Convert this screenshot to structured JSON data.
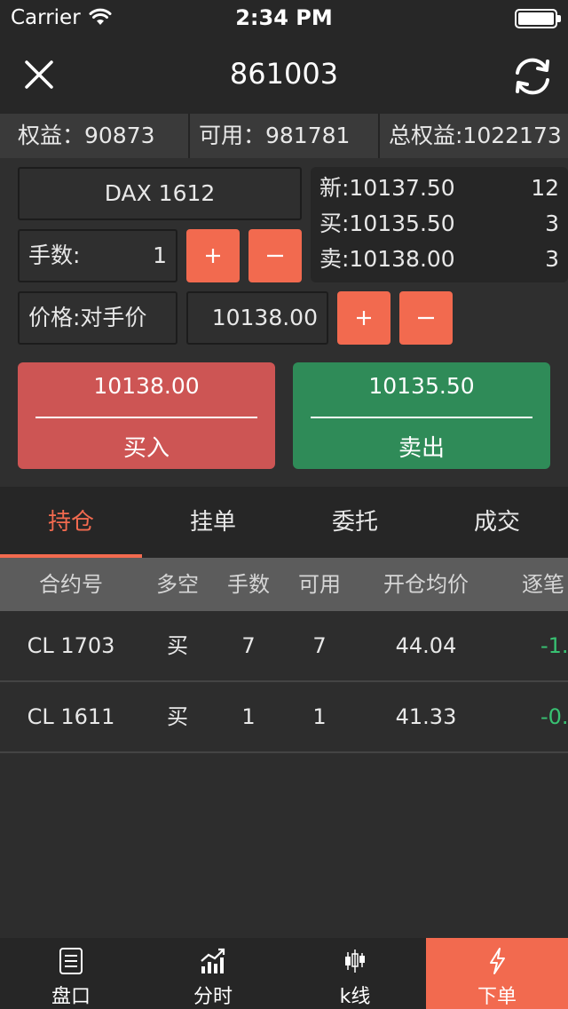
{
  "status_bar": {
    "carrier": "Carrier",
    "time": "2:34 PM"
  },
  "nav": {
    "title": "861003"
  },
  "account": {
    "equity": "权益：90873",
    "available": "可用：981781",
    "total_equity": "总权益:1022173"
  },
  "order": {
    "symbol": "DAX 1612",
    "qty_label": "手数:",
    "qty_value": "1",
    "price_type": "价格:对手价",
    "price_value": "10138.00",
    "plus_symbol": "+",
    "minus_symbol": "−"
  },
  "quote": {
    "last": {
      "price": "新:10137.50",
      "volume": "12"
    },
    "bid": {
      "price": "买:10135.50",
      "volume": "3"
    },
    "ask": {
      "price": "卖:10138.00",
      "volume": "3"
    }
  },
  "buy_button": {
    "price": "10138.00",
    "label": "买入"
  },
  "sell_button": {
    "price": "10135.50",
    "label": "卖出"
  },
  "tabs": [
    {
      "label": "持仓"
    },
    {
      "label": "挂单"
    },
    {
      "label": "委托"
    },
    {
      "label": "成交"
    }
  ],
  "active_tab": "持仓",
  "table": {
    "headers": [
      "合约号",
      "多空",
      "手数",
      "可用",
      "开仓均价",
      "逐笔"
    ],
    "rows": [
      [
        "CL 1703",
        "买",
        "7",
        "7",
        "44.04",
        "-1."
      ],
      [
        "CL 1611",
        "买",
        "1",
        "1",
        "41.33",
        "-0."
      ]
    ]
  },
  "tabbar": [
    {
      "label": "盘口",
      "icon": "list-icon"
    },
    {
      "label": "分时",
      "icon": "chart-trend-icon"
    },
    {
      "label": "k线",
      "icon": "candlestick-icon"
    },
    {
      "label": "下单",
      "icon": "lightning-icon"
    }
  ],
  "colors": {
    "accent": "#f26a4f",
    "buy": "#cd5554",
    "sell": "#2f8b58",
    "profit_text": "#38c172"
  }
}
